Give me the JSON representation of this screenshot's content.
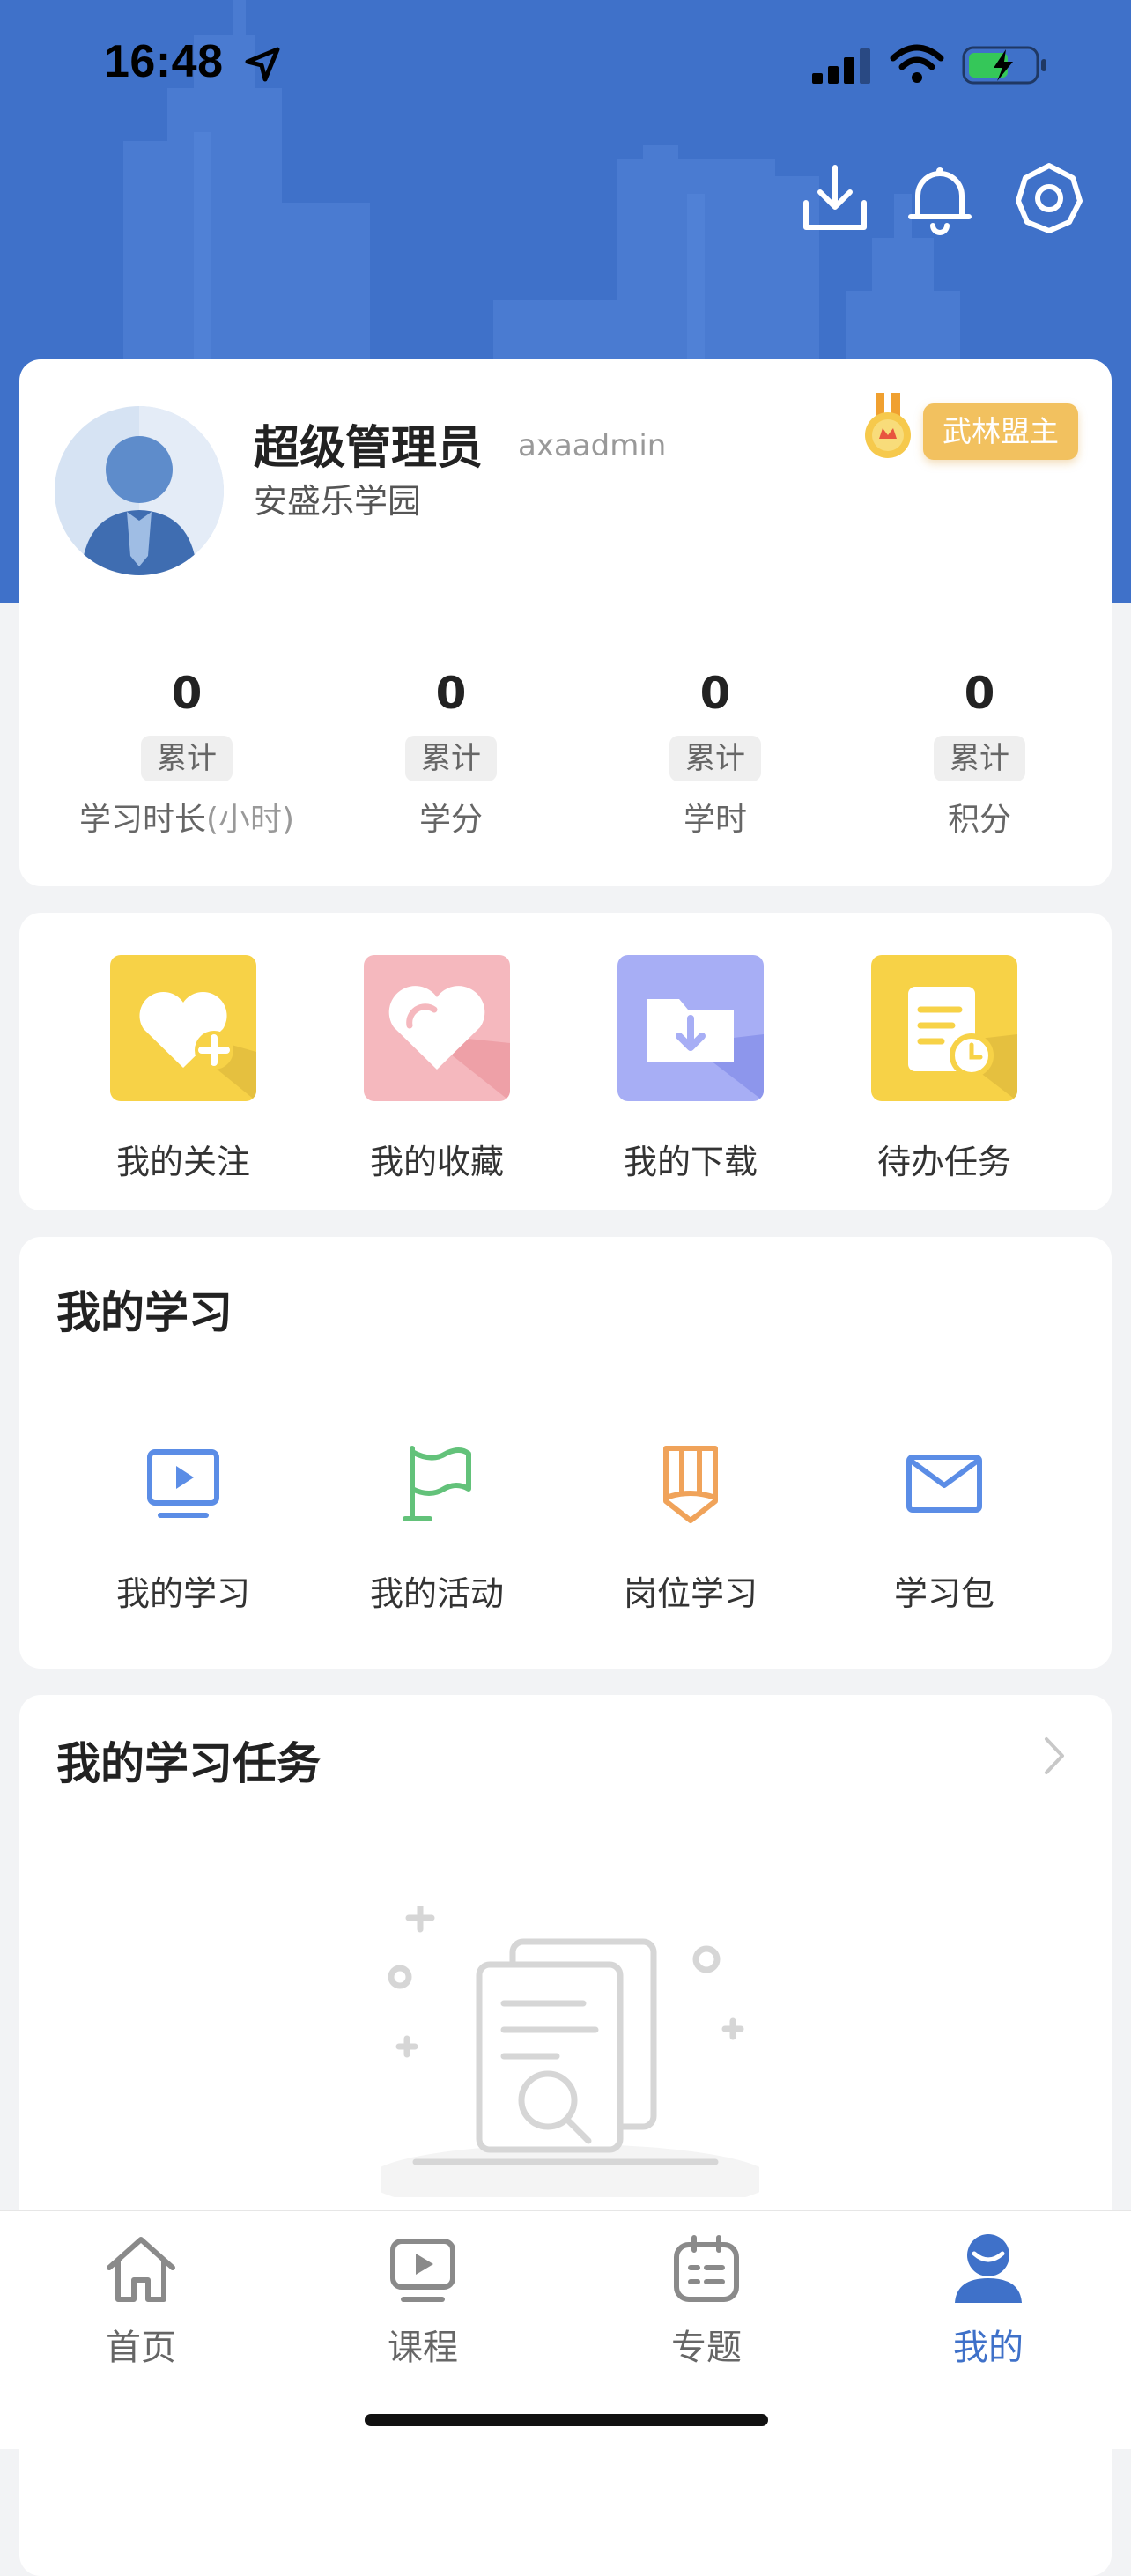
{
  "status_bar": {
    "time": "16:48"
  },
  "header": {
    "download_icon": "download-icon",
    "bell_icon": "bell-icon",
    "settings_icon": "gear-icon"
  },
  "profile": {
    "name": "超级管理员",
    "account": "axaadmin",
    "organization": "安盛乐学园",
    "rank": "武林盟主"
  },
  "stats": [
    {
      "value": "0",
      "tag": "累计",
      "label": "学习时长",
      "sublabel": "(小时)"
    },
    {
      "value": "0",
      "tag": "累计",
      "label": "学分",
      "sublabel": ""
    },
    {
      "value": "0",
      "tag": "累计",
      "label": "学时",
      "sublabel": ""
    },
    {
      "value": "0",
      "tag": "累计",
      "label": "积分",
      "sublabel": ""
    }
  ],
  "quick_actions": [
    {
      "label": "我的关注",
      "icon": "heart-plus-icon",
      "color": "#f7d247"
    },
    {
      "label": "我的收藏",
      "icon": "heart-icon",
      "color": "#f5b8be"
    },
    {
      "label": "我的下载",
      "icon": "folder-download-icon",
      "color": "#a7aef5"
    },
    {
      "label": "待办任务",
      "icon": "document-clock-icon",
      "color": "#f7d247"
    }
  ],
  "my_study": {
    "title": "我的学习",
    "items": [
      {
        "label": "我的学习",
        "icon": "play-screen-icon"
      },
      {
        "label": "我的活动",
        "icon": "flag-icon"
      },
      {
        "label": "岗位学习",
        "icon": "pencil-badge-icon"
      },
      {
        "label": "学习包",
        "icon": "envelope-icon"
      }
    ]
  },
  "tasks": {
    "title": "我的学习任务"
  },
  "tabbar": {
    "items": [
      {
        "label": "首页",
        "icon": "home-icon"
      },
      {
        "label": "课程",
        "icon": "video-icon"
      },
      {
        "label": "专题",
        "icon": "topic-icon"
      },
      {
        "label": "我的",
        "icon": "user-icon"
      }
    ],
    "active_color": "#3f71c9"
  },
  "colors": {
    "brand": "#3f71c9",
    "badge": "#f2c15f"
  }
}
